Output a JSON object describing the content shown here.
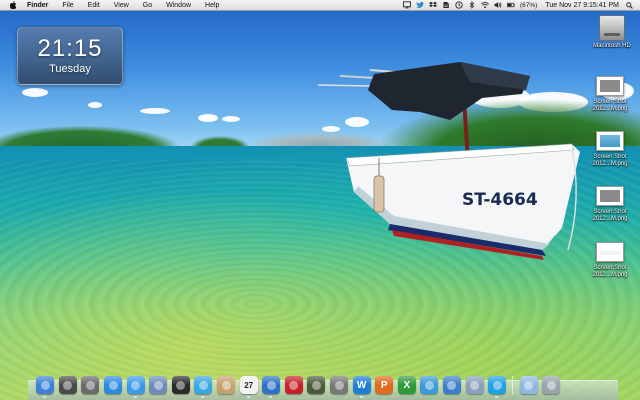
{
  "menubar": {
    "app_name": "Finder",
    "items": [
      "File",
      "Edit",
      "View",
      "Go",
      "Window",
      "Help"
    ],
    "battery": "(67%)",
    "datetime": "Tue Nov 27  9:15:41 PM",
    "status_icons": [
      "display-icon",
      "twitter-icon",
      "dropbox-icon",
      "evernote-icon",
      "timemachine-icon",
      "bluetooth-icon",
      "wifi-icon",
      "volume-icon",
      "battery-icon"
    ]
  },
  "clock_widget": {
    "time": "21:15",
    "day": "Tuesday"
  },
  "desktop_icons": [
    {
      "label": "Macintosh HD",
      "icon": "hard-drive-icon"
    },
    {
      "label": "Screen Shot\n2012...M.png",
      "icon": "screenshot-file-icon"
    },
    {
      "label": "Screen Shot\n2012...M.png",
      "icon": "screenshot-file-icon"
    },
    {
      "label": "Screen Shot\n2012...M.png",
      "icon": "screenshot-file-icon"
    },
    {
      "label": "Screen Shot\n2012...M.png",
      "icon": "screenshot-file-icon"
    }
  ],
  "wallpaper": {
    "boat_registration": "ST-4664"
  },
  "dock": {
    "items": [
      {
        "name": "finder",
        "color": "#3b82d6"
      },
      {
        "name": "dashboard",
        "color": "#4a4a4a"
      },
      {
        "name": "launchpad",
        "color": "#6b6b6b"
      },
      {
        "name": "app-store",
        "color": "#2f8be0"
      },
      {
        "name": "safari",
        "color": "#3a9ae8"
      },
      {
        "name": "preview",
        "color": "#6d8cb8"
      },
      {
        "name": "photo-booth",
        "color": "#2a2a2a"
      },
      {
        "name": "twitter",
        "color": "#39a7e0"
      },
      {
        "name": "contacts",
        "color": "#c8a070"
      },
      {
        "name": "calendar",
        "color": "#f2f2f2",
        "text": "27"
      },
      {
        "name": "itunes",
        "color": "#2f72c8"
      },
      {
        "name": "photoshop",
        "color": "#c8202a"
      },
      {
        "name": "iphoto",
        "color": "#4a5a3a"
      },
      {
        "name": "image-capture",
        "color": "#777777"
      },
      {
        "name": "word",
        "color": "#1f7fd6",
        "text": "W"
      },
      {
        "name": "powerpoint",
        "color": "#e06a20",
        "text": "P"
      },
      {
        "name": "excel",
        "color": "#2f9a3a",
        "text": "X"
      },
      {
        "name": "messenger",
        "color": "#3b9bd8"
      },
      {
        "name": "network",
        "color": "#3b7fc8"
      },
      {
        "name": "activity-monitor",
        "color": "#8aa0b8"
      },
      {
        "name": "skype",
        "color": "#1fa0e6"
      }
    ],
    "right_items": [
      {
        "name": "downloads-folder",
        "color": "#8fb8e0"
      },
      {
        "name": "trash",
        "color": "#9aa4ac"
      }
    ]
  }
}
